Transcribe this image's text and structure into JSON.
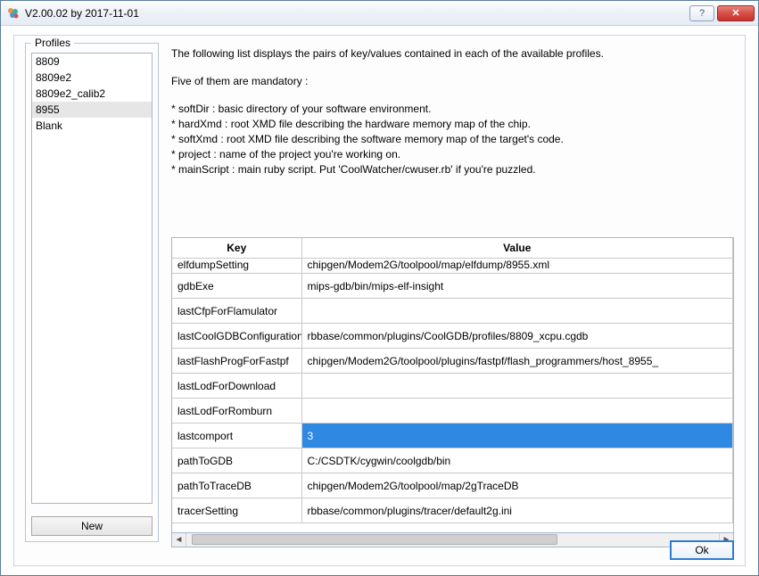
{
  "titlebar": {
    "title": "V2.00.02 by 2017-11-01",
    "help_symbol": "?",
    "close_symbol": "✕"
  },
  "profiles": {
    "legend": "Profiles",
    "items": [
      {
        "label": "8809",
        "selected": false
      },
      {
        "label": "8809e2",
        "selected": false
      },
      {
        "label": "8809e2_calib2",
        "selected": false
      },
      {
        "label": "8955",
        "selected": true
      },
      {
        "label": "Blank",
        "selected": false
      }
    ],
    "new_label": "New"
  },
  "description": {
    "line1": "The following list displays the pairs of key/values contained in each of the available profiles.",
    "line2": "Five of them are mandatory :",
    "b0": "* softDir : basic directory of your software environment.",
    "b1": "* hardXmd : root XMD file describing the hardware memory map of the chip.",
    "b2": "* softXmd : root XMD file describing the software memory map of the target's code.",
    "b3": "* project : name of the project you're working on.",
    "b4": "* mainScript : main ruby script. Put 'CoolWatcher/cwuser.rb' if you're puzzled."
  },
  "table": {
    "headers": {
      "key": "Key",
      "value": "Value"
    },
    "rows": [
      {
        "key": "elfdumpSetting",
        "value": "chipgen/Modem2G/toolpool/map/elfdump/8955.xml",
        "cut": true
      },
      {
        "key": "gdbExe",
        "value": "mips-gdb/bin/mips-elf-insight"
      },
      {
        "key": "lastCfpForFlamulator",
        "value": ""
      },
      {
        "key": "lastCoolGDBConfiguration",
        "value": "rbbase/common/plugins/CoolGDB/profiles/8809_xcpu.cgdb"
      },
      {
        "key": "lastFlashProgForFastpf",
        "value": "chipgen/Modem2G/toolpool/plugins/fastpf/flash_programmers/host_8955_"
      },
      {
        "key": "lastLodForDownload",
        "value": ""
      },
      {
        "key": "lastLodForRomburn",
        "value": ""
      },
      {
        "key": "lastcomport",
        "value": "3",
        "selected": true
      },
      {
        "key": "pathToGDB",
        "value": "C:/CSDTK/cygwin/coolgdb/bin"
      },
      {
        "key": "pathToTraceDB",
        "value": "chipgen/Modem2G/toolpool/map/2gTraceDB"
      },
      {
        "key": "tracerSetting",
        "value": "rbbase/common/plugins/tracer/default2g.ini"
      }
    ]
  },
  "footer": {
    "ok_label": "Ok"
  }
}
